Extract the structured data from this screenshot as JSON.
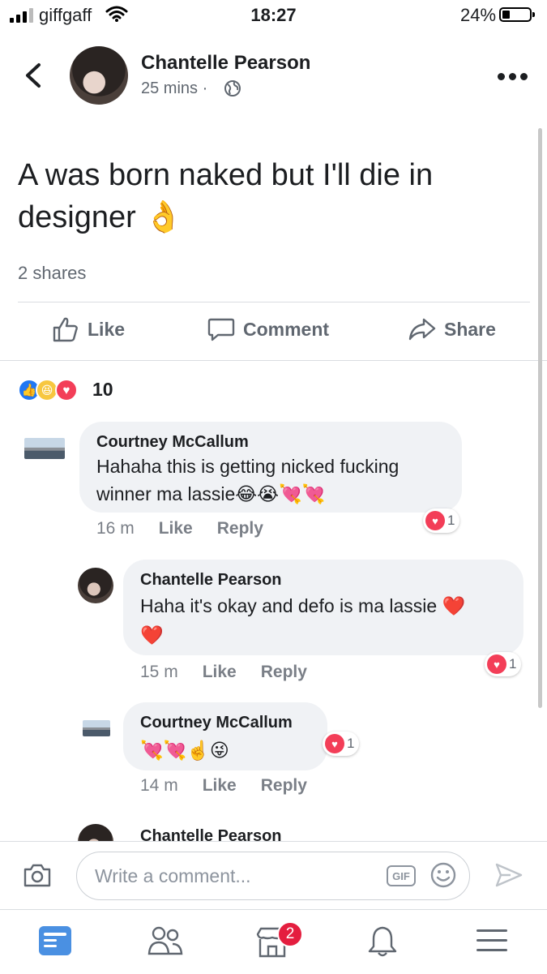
{
  "status_bar": {
    "carrier": "giffgaff",
    "time": "18:27",
    "battery": "24%"
  },
  "post": {
    "author": "Chantelle Pearson",
    "time": "25 mins",
    "separator": "·",
    "text": "A was born naked but I'll die in designer 👌",
    "shares": "2 shares",
    "actions": {
      "like": "Like",
      "comment": "Comment",
      "share": "Share"
    },
    "reaction_count": "10"
  },
  "comments": [
    {
      "name": "Courtney McCallum",
      "text_line1": "Hahaha this is getting nicked fucking",
      "text_line2": "winner ma lassie😂😭💘💘",
      "time": "16 m",
      "like": "Like",
      "reply": "Reply",
      "reactions": "1"
    },
    {
      "name": "Chantelle Pearson",
      "text_line1": "Haha it's okay and defo is ma lassie ❤️",
      "text_line2": "❤️",
      "time": "15 m",
      "like": "Like",
      "reply": "Reply",
      "reactions": "1"
    },
    {
      "name": "Courtney McCallum",
      "text_line1": "💘💘☝️😜",
      "time": "14 m",
      "like": "Like",
      "reply": "Reply",
      "reactions": "1"
    },
    {
      "name": "Chantelle Pearson"
    }
  ],
  "composer": {
    "placeholder": "Write a comment...",
    "gif_label": "GIF"
  },
  "tab_bar": {
    "marketplace_badge": "2"
  },
  "colors": {
    "like_blue": "#2078f4",
    "love_red": "#f33e58",
    "haha_yellow": "#f7c740",
    "badge_red": "#e41e3f",
    "active_tab": "#4a90e2"
  }
}
